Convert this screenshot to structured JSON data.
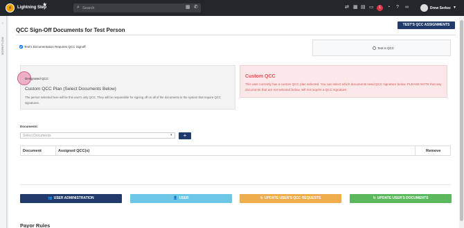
{
  "topbar": {
    "logo_letter": "⚡",
    "app_name": "Lightning Step",
    "favorite_icon": "star-icon",
    "search_placeholder": "Search",
    "user_name": "Drew Serkez",
    "notification_count": "1"
  },
  "sidebar": {
    "tab_label": "WORKFLOW"
  },
  "page": {
    "title": "QCC Sign-Off Documents for Test Person",
    "assignments_button": "TEST'S QCC ASSIGNMENTS"
  },
  "options": {
    "requires_signoff_label": "Test's Documentation Requires QCC Signoff",
    "requires_signoff_checked": true,
    "test_is_qcc_label": "Test is QCC",
    "test_is_qcc_checked": false
  },
  "designated_qcc": {
    "label": "Designated QCC",
    "plan": "Custom QCC Plan (Select Documents Below)",
    "description": "The person selected here will be this user's only QCC. They will be responsible for signing off on all of the documents in the system that require QCC signatures."
  },
  "custom_qcc": {
    "title": "Custom QCC",
    "description": "This user currently has a custom QCC plan selected. You can select which documents need QCC signature below. PLEASE NOTE that any documents that are not selected below, will not require a QCC signature."
  },
  "documents": {
    "label": "Documents:",
    "select_placeholder": "Select Documents",
    "add_button": "+",
    "columns": [
      "Document",
      "Assigned QCC(s)",
      "Remove"
    ],
    "rows": []
  },
  "actions": {
    "user_administration": "USER ADMINISTRATION",
    "user": "USER",
    "update_qcc_requests": "UPDATE USER'S QCC REQUESTS",
    "update_documents": "UPDATE USER'S DOCUMENTS"
  },
  "sections": {
    "payor_rules": "Payor Rules"
  },
  "colors": {
    "topbar": "#23272b",
    "primary": "#1f3a6b",
    "info": "#6ec6e6",
    "warning": "#f0ad4e",
    "success": "#5cb85c",
    "danger": "#d9534f"
  }
}
